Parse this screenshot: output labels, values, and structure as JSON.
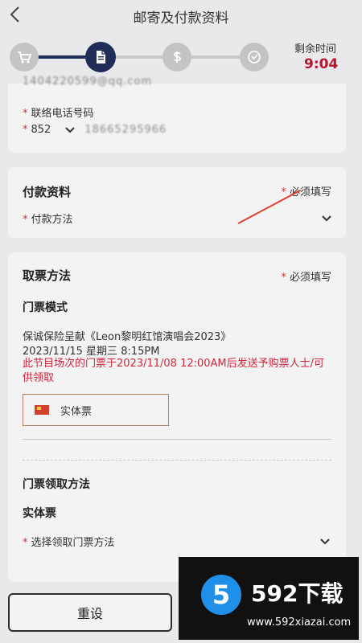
{
  "header": {
    "back_icon": "chevron-left-icon",
    "title": "邮寄及付款资料"
  },
  "steps": [
    {
      "icon": "cart-icon",
      "state": "done"
    },
    {
      "icon": "document-icon",
      "state": "active"
    },
    {
      "icon": "dollar-icon",
      "state": "pending"
    },
    {
      "icon": "check-circle-icon",
      "state": "pending"
    }
  ],
  "timer": {
    "label": "剩余时间",
    "value": "9:04"
  },
  "contact": {
    "email_value": "1404220599@qq.com",
    "phone_label": "联络电话号码",
    "country_code": "852",
    "phone_value": "18665295966"
  },
  "payment": {
    "title": "付款资料",
    "required": "必须填写",
    "method_label": "付款方法"
  },
  "ticket": {
    "title": "取票方法",
    "required": "必须填写",
    "mode_title": "门票模式",
    "event_name": "保诚保险呈献《Leon黎明红馆演唱会2023》",
    "event_datetime": "2023/11/15 星期三 8:15PM",
    "notice": "此节目场次的门票于2023/11/08 12:00AM后发送予购票人士/可供领取",
    "physical_ticket_label": "实体票",
    "pickup_title": "门票领取方法",
    "pickup_subtitle": "实体票",
    "pickup_select": "选择领取门票方法"
  },
  "footer": {
    "reset_label": "重设"
  },
  "promo": {
    "brand": "592下载",
    "logo_char": "5",
    "url": "www.592xiazai.com"
  },
  "colors": {
    "accent": "#1f2d57",
    "timer": "#b3152d",
    "required": "#c0392b",
    "notice": "#d0263a"
  }
}
